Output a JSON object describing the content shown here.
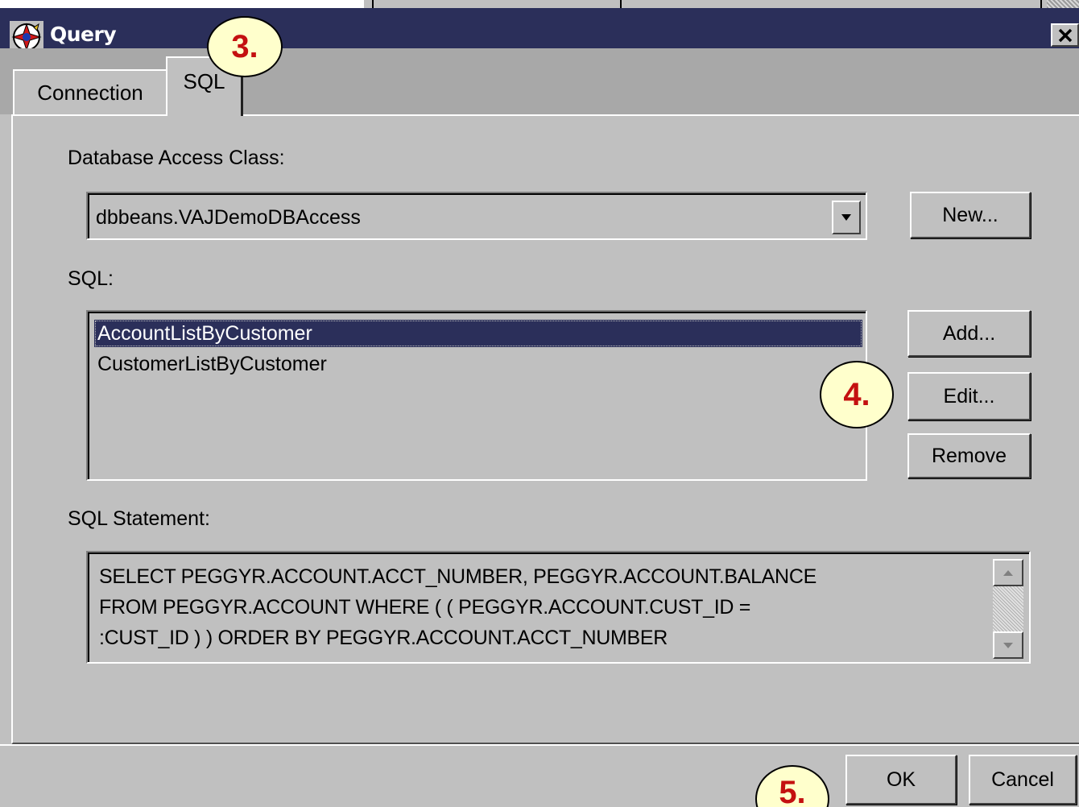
{
  "window": {
    "title": "Query",
    "close_glyph": "✕"
  },
  "tabs": [
    {
      "label": "Connection",
      "active": false
    },
    {
      "label": "SQL",
      "active": true
    }
  ],
  "sql_tab": {
    "db_access_label": "Database Access Class:",
    "db_access_value": "dbbeans.VAJDemoDBAccess",
    "new_button": "New...",
    "sql_label": "SQL:",
    "sql_items": [
      "AccountListByCustomer",
      "CustomerListByCustomer"
    ],
    "selected_index": 0,
    "add_button": "Add...",
    "edit_button": "Edit...",
    "remove_button": "Remove",
    "statement_label": "SQL Statement:",
    "statement_lines": [
      "SELECT PEGGYR.ACCOUNT.ACCT_NUMBER, PEGGYR.ACCOUNT.BALANCE",
      "FROM PEGGYR.ACCOUNT WHERE ( ( PEGGYR.ACCOUNT.CUST_ID =",
      ":CUST_ID ) ) ORDER BY PEGGYR.ACCOUNT.ACCT_NUMBER"
    ]
  },
  "footer": {
    "ok_button": "OK",
    "cancel_button": "Cancel"
  },
  "annotations": [
    "3.",
    "4.",
    "5."
  ],
  "colors": {
    "titlebar": "#2b2f5a",
    "selection": "#2b2f5a",
    "callout_text": "#c41010",
    "callout_fill": "#ffffcc",
    "face": "#c0c0c0"
  },
  "icons": {
    "app": "app-icon",
    "close": "close-icon",
    "dropdown": "dropdown-arrow-icon",
    "scroll_up": "scroll-up-arrow-icon",
    "scroll_down": "scroll-down-arrow-icon"
  }
}
